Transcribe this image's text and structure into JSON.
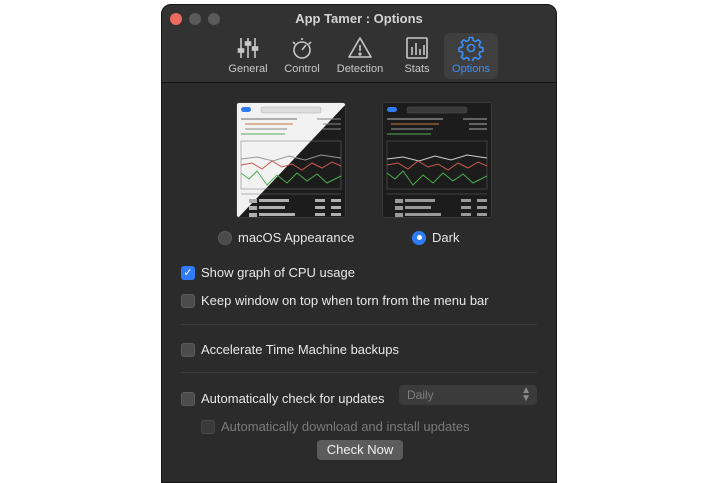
{
  "window": {
    "title": "App Tamer : Options"
  },
  "toolbar": {
    "items": [
      {
        "label": "General",
        "icon": "sliders-icon"
      },
      {
        "label": "Control",
        "icon": "gauge-icon"
      },
      {
        "label": "Detection",
        "icon": "warning-icon"
      },
      {
        "label": "Stats",
        "icon": "bar-chart-icon"
      },
      {
        "label": "Options",
        "icon": "gear-icon",
        "active": true
      }
    ],
    "active_color": "#3e8ef7"
  },
  "appearance": {
    "options": [
      {
        "label": "macOS Appearance",
        "selected": false
      },
      {
        "label": "Dark",
        "selected": true
      }
    ]
  },
  "settings": {
    "show_graph": {
      "label": "Show graph of CPU usage",
      "checked": true
    },
    "keep_on_top": {
      "label": "Keep window on top when torn from the menu bar",
      "checked": false
    },
    "accelerate_tm": {
      "label": "Accelerate Time Machine backups",
      "checked": false
    },
    "auto_check": {
      "label": "Automatically check for updates",
      "checked": false
    },
    "auto_download": {
      "label": "Automatically download and install updates",
      "checked": false,
      "enabled": false
    },
    "frequency": {
      "value": "Daily"
    },
    "check_now": {
      "label": "Check Now"
    }
  },
  "colors": {
    "accent": "#2f7cf6",
    "close": "#ed6a5e",
    "window_bg": "#2b2b2b"
  }
}
